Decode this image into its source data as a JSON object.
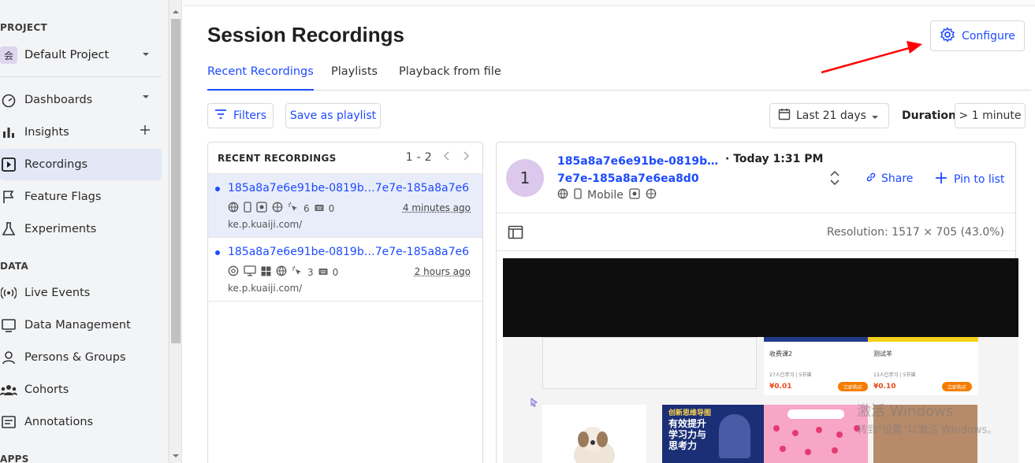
{
  "sidebar": {
    "project_section": "PROJECT",
    "project_name": "Default Project",
    "project_badge": "会",
    "data_section": "DATA",
    "apps_section": "APPS",
    "items": [
      {
        "label": "Dashboards",
        "icon": "gauge-icon"
      },
      {
        "label": "Insights",
        "icon": "bar-chart-icon"
      },
      {
        "label": "Recordings",
        "icon": "play-square-icon"
      },
      {
        "label": "Feature Flags",
        "icon": "flag-icon"
      },
      {
        "label": "Experiments",
        "icon": "flask-icon"
      }
    ],
    "data_items": [
      {
        "label": "Live Events",
        "icon": "broadcast-icon"
      },
      {
        "label": "Data Management",
        "icon": "database-icon"
      },
      {
        "label": "Persons & Groups",
        "icon": "person-icon"
      },
      {
        "label": "Cohorts",
        "icon": "users-icon"
      },
      {
        "label": "Annotations",
        "icon": "annotation-icon"
      }
    ]
  },
  "header": {
    "title": "Session Recordings",
    "configure_label": "Configure"
  },
  "tabs": [
    {
      "label": "Recent Recordings",
      "active": true
    },
    {
      "label": "Playlists",
      "active": false
    },
    {
      "label": "Playback from file",
      "active": false
    }
  ],
  "filters": {
    "filters_label": "Filters",
    "save_playlist_label": "Save as playlist",
    "date_range": "Last 21 days",
    "duration_label": "Duration",
    "duration_value": "> 1 minute"
  },
  "recordings": {
    "heading": "RECENT RECORDINGS",
    "page_range": "1 - 2",
    "items": [
      {
        "id": "185a8a7e6e91be-0819b…7e7e-185a8a7e6",
        "clicks": "6",
        "keys": "0",
        "ago": "4 minutes ago",
        "url": "ke.p.kuaiji.com/"
      },
      {
        "id": "185a8a7e6e91be-0819b…7e7e-185a8a7e6",
        "clicks": "3",
        "keys": "0",
        "ago": "2 hours ago",
        "url": "ke.p.kuaiji.com/"
      }
    ]
  },
  "player": {
    "avatar": "1",
    "id_line1": "185a8a7e6e91be-0819b…",
    "id_line2": "7e7e-185a8a7e6ea8d0",
    "time": "· Today 1:31 PM",
    "device": "Mobile",
    "share_label": "Share",
    "pin_label": "Pin to list",
    "resolution": "Resolution: 1517 × 705 (43.0%)"
  },
  "viewport": {
    "card1_title": "收费课2",
    "card1_sub": "27人已学习 | 5节课",
    "card1_price": "¥0.01",
    "card2_title": "测试羊",
    "card2_sub": "13人已学习 | 5节课",
    "card2_price": "¥0.10",
    "buy_label": "立即购买",
    "thumb2_title": "创新思维导图",
    "thumb2_line1": "有效提升",
    "thumb2_line2": "学习力与",
    "thumb2_line3": "思考力"
  },
  "watermark": {
    "line1": "激活 Windows",
    "line2": "转到\"设置\"以激活 Windows。"
  },
  "colors": {
    "accent": "#1d4aff",
    "arrow": "#ff0000"
  }
}
